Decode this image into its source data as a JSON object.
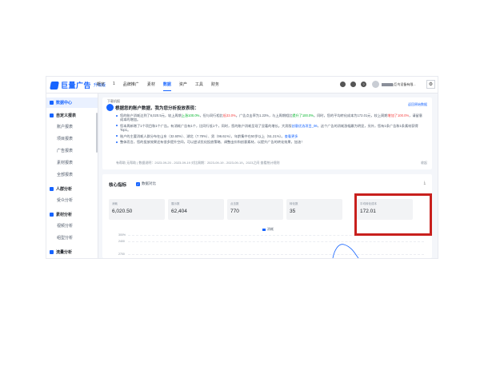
{
  "brand": {
    "name": "巨量广告",
    "edition": "升级版"
  },
  "nav": {
    "items": [
      "概览",
      "1",
      "品牌推广",
      "素材",
      "数据",
      "资产",
      "工具",
      "财务"
    ],
    "active_index": 4
  },
  "account": {
    "name_suffix": "(巨鸟设备有限..."
  },
  "sidebar": {
    "home": "数据中心",
    "sections": [
      {
        "title": "自定义报表",
        "items": [
          "账户报表",
          "项目报表",
          "广告报表",
          "素材报表",
          "全部报表"
        ]
      },
      {
        "title": "人群分析",
        "items": [
          "受众分析"
        ]
      },
      {
        "title": "素材分析",
        "items": [
          "视频分析",
          "组型分析"
        ]
      },
      {
        "title": "流量分析",
        "items": []
      }
    ]
  },
  "notice": {
    "tag": "下载机报",
    "title": "根据您的账户数据，我为您分析投放表现：",
    "more": "返回原始数据",
    "bullets": [
      {
        "parts": [
          {
            "t": "您的账户消耗达到了6,020.5元，较上周期"
          },
          {
            "t": "上涨100.0%",
            "c": "g"
          },
          {
            "t": "，但与同行相比"
          },
          {
            "t": "低33.0%",
            "c": "r"
          },
          {
            "t": "。广告点击率为1.23%，与上周期相比"
          },
          {
            "t": "提升了100.0%",
            "c": "g"
          },
          {
            "t": "。同时，您的平均转化成本为172.01元，较上周期"
          },
          {
            "t": "增加了100.0%",
            "c": "r"
          },
          {
            "t": "，请留意成本的增加。"
          }
        ]
      },
      {
        "parts": [
          {
            "t": "您本周新增了1个项目和1个广告。有消耗广告有1个，比同行低1个，同时，您的账户消耗呈现了显著的增长。大男版"
          },
          {
            "t": "创意优选项目_06",
            "c": "b"
          },
          {
            "t": "，这个广告的消耗涨幅最为明显，另外，您有1条广告和1条素材获得Top1。"
          }
        ]
      },
      {
        "parts": [
          {
            "t": "账户的主要消耗人群分布在山东（32.60%）、湖北（7.78%）、男（96.61%），年龄集中在50岁以上（51.21%）。"
          },
          {
            "t": "查看更多",
            "c": "b"
          }
        ]
      },
      {
        "parts": [
          {
            "t": "整体而言，您的投放效果还有很多提升空间，可以尝试优化投放策略、调整出价和创意素材，以提升广告的转化效果，加油！"
          }
        ]
      }
    ],
    "footer": "有帮助  无帮助  |  数据说明：2023-09-20 - 2023-09-19  对比周期：2023-09-19 - 2023-09-19，2023之间  查看统计规则",
    "expand": "收起"
  },
  "core": {
    "title": "核心指标",
    "compare_label": "数据对比",
    "metrics": [
      {
        "label": "消耗",
        "value": "6,020.50"
      },
      {
        "label": "展示数",
        "value": "62,404"
      },
      {
        "label": "点击数",
        "value": "770"
      },
      {
        "label": "转化数",
        "value": "35"
      },
      {
        "label": "平均转化成本",
        "value": "172.01"
      }
    ],
    "legend": "消耗",
    "y_ticks": [
      "300%",
      "2400",
      "2700"
    ]
  },
  "colors": {
    "accent": "#1664ff",
    "highlight": "#c8201d"
  }
}
